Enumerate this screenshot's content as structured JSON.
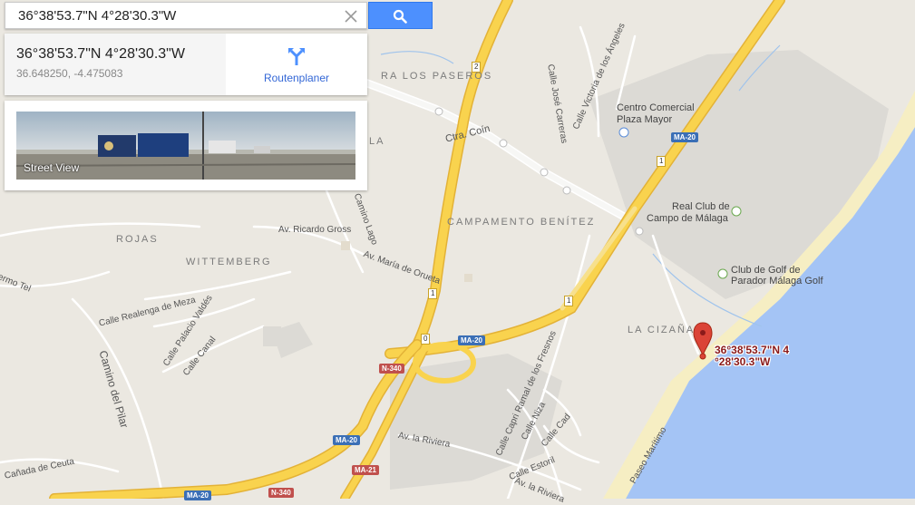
{
  "search": {
    "value": "36°38'53.7\"N 4°28'30.3\"W",
    "clear_icon": "close-icon",
    "search_icon": "search-icon"
  },
  "result": {
    "title": "36°38'53.7\"N 4°28'30.3\"W",
    "decimal": "36.648250, -4.475083",
    "route_label": "Routenplaner",
    "route_icon": "directions-icon"
  },
  "streetview": {
    "label": "Street View"
  },
  "marker": {
    "label_line1": "36°38'53.7\"N 4",
    "label_line2": "°28'30.3\"W",
    "color": "#db4437"
  },
  "colors": {
    "land": "#ebe8e1",
    "sea": "#a4c4f5",
    "beach": "#f6eec3",
    "highway": "#f9d34e",
    "highway_border": "#e3b237",
    "search_button": "#4d90fe",
    "link": "#3367d6"
  },
  "labels": {
    "areas": {
      "los_paseros": "RA LOS PASEROS",
      "la": "LA",
      "campamento": "CAMPAMENTO BENÍTEZ",
      "rojas": "ROJAS",
      "wittemberg": "WITTEMBERG",
      "la_cizana": "LA CIZAÑA"
    },
    "pois": {
      "centro_comercial": "Centro Comercial",
      "plaza_mayor": "Plaza Mayor",
      "real_club": "Real Club de",
      "campo_malaga": "Campo de Málaga",
      "club_golf": "Club de Golf de",
      "parador": "Parador Málaga Golf"
    },
    "streets": {
      "jose_carreras": "Calle José Carreras",
      "victoria_angeles": "Calle Victoria de los Ángeles",
      "ctra_coin": "Ctra. Coín",
      "camino_lago": "Camino Lago",
      "ricardo_gross": "Av. Ricardo Gross",
      "maria_orueta": "Av. María de Orueta",
      "realenga": "Calle Realenga de Meza",
      "palacio_valdes": "Calle Palacio Valdés",
      "calle_canal": "Calle Canal",
      "camino_pilar": "Camino del Pilar",
      "canada_ceuta": "Cañada de Ceuta",
      "ermo_tel": "ermo Tel",
      "ramal_fresnos": "Calle Capri Ramal de los Fresnos",
      "av_riviera": "Av. la Riviera",
      "calle_niza": "Calle Niza",
      "calle_cad": "Calle Cad",
      "calle_estoril": "Calle Estoril",
      "av_la_riviera2": "Av. la Riviera",
      "paseo_maritimo": "Paseo Marítimo"
    },
    "shields": {
      "ma20_a": "MA-20",
      "ma20_b": "MA-20",
      "ma20_c": "MA-20",
      "ma20_d": "MA-20",
      "n340_a": "N-340",
      "n340_b": "N-340",
      "ma21": "MA-21"
    },
    "km": {
      "k2": "2",
      "k1a": "1",
      "k1b": "1",
      "k1c": "1",
      "k0": "0"
    }
  }
}
